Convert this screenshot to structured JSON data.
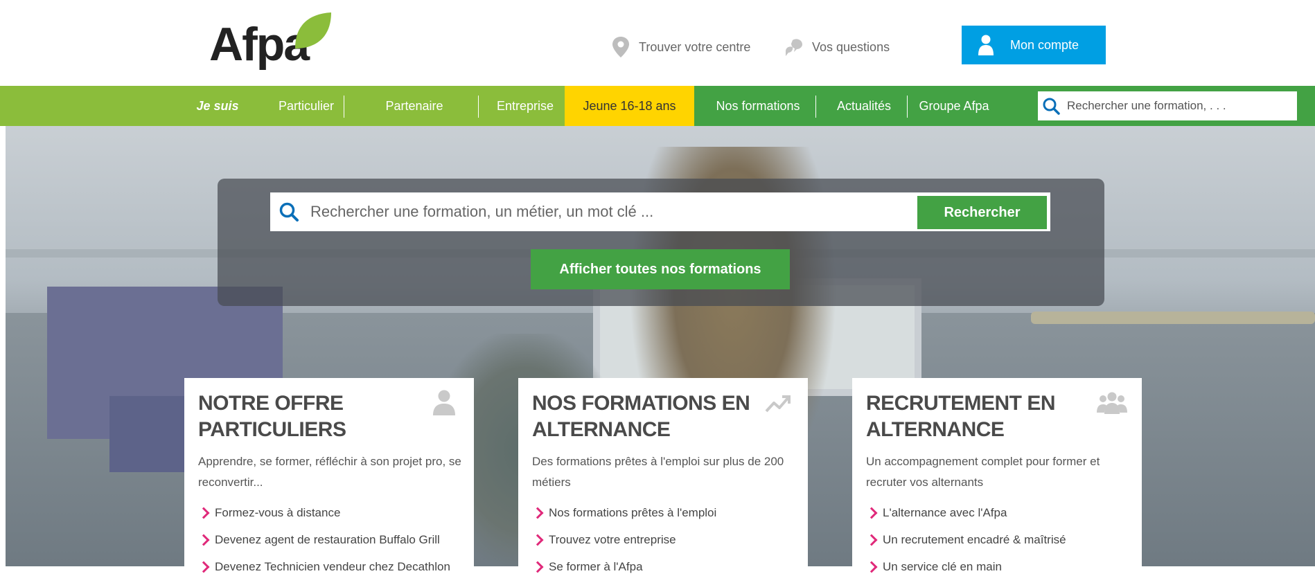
{
  "header": {
    "logo_text": "Afpa",
    "links": [
      {
        "label": "Trouver votre centre",
        "icon": "map-pin-icon"
      },
      {
        "label": "Vos questions",
        "icon": "chat-bubbles-icon"
      }
    ],
    "account_label": "Mon compte"
  },
  "nav": {
    "lead": "Je suis",
    "items": [
      "Particulier",
      "Partenaire",
      "Entreprise",
      "Jeune 16-18 ans",
      "Nos formations",
      "Actualités",
      "Groupe Afpa"
    ],
    "search_placeholder": "Rechercher une formation, . . ."
  },
  "hero": {
    "search_placeholder": "Rechercher une formation, un métier, un mot clé ...",
    "search_button": "Rechercher",
    "all_button": "Afficher toutes nos formations"
  },
  "cards": [
    {
      "title": "NOTRE OFFRE\nPARTICULIERS",
      "icon": "person-icon",
      "desc": "Apprendre, se former, réfléchir à son projet pro, se reconvertir...",
      "links": [
        "Formez-vous à distance",
        "Devenez agent de restauration Buffalo Grill",
        "Devenez Technicien vendeur chez Decathlon"
      ]
    },
    {
      "title": "NOS FORMATIONS EN\nALTERNANCE",
      "icon": "trend-up-icon",
      "desc": "Des formations prêtes à l'emploi sur plus de 200 métiers",
      "links": [
        "Nos formations prêtes à l'emploi",
        "Trouvez votre entreprise",
        "Se former à l'Afpa"
      ]
    },
    {
      "title": "RECRUTEMENT EN\nALTERNANCE",
      "icon": "group-icon",
      "desc": "Un accompagnement complet pour former et recruter vos alternants",
      "links": [
        "L'alternance avec l'Afpa",
        "Un recrutement encadré & maîtrisé",
        "Un service clé en main"
      ]
    }
  ],
  "colors": {
    "green_light": "#8bbd3b",
    "green_dark": "#43a244",
    "yellow": "#ffd400",
    "blue": "#009fe3",
    "pink": "#e0297a"
  }
}
